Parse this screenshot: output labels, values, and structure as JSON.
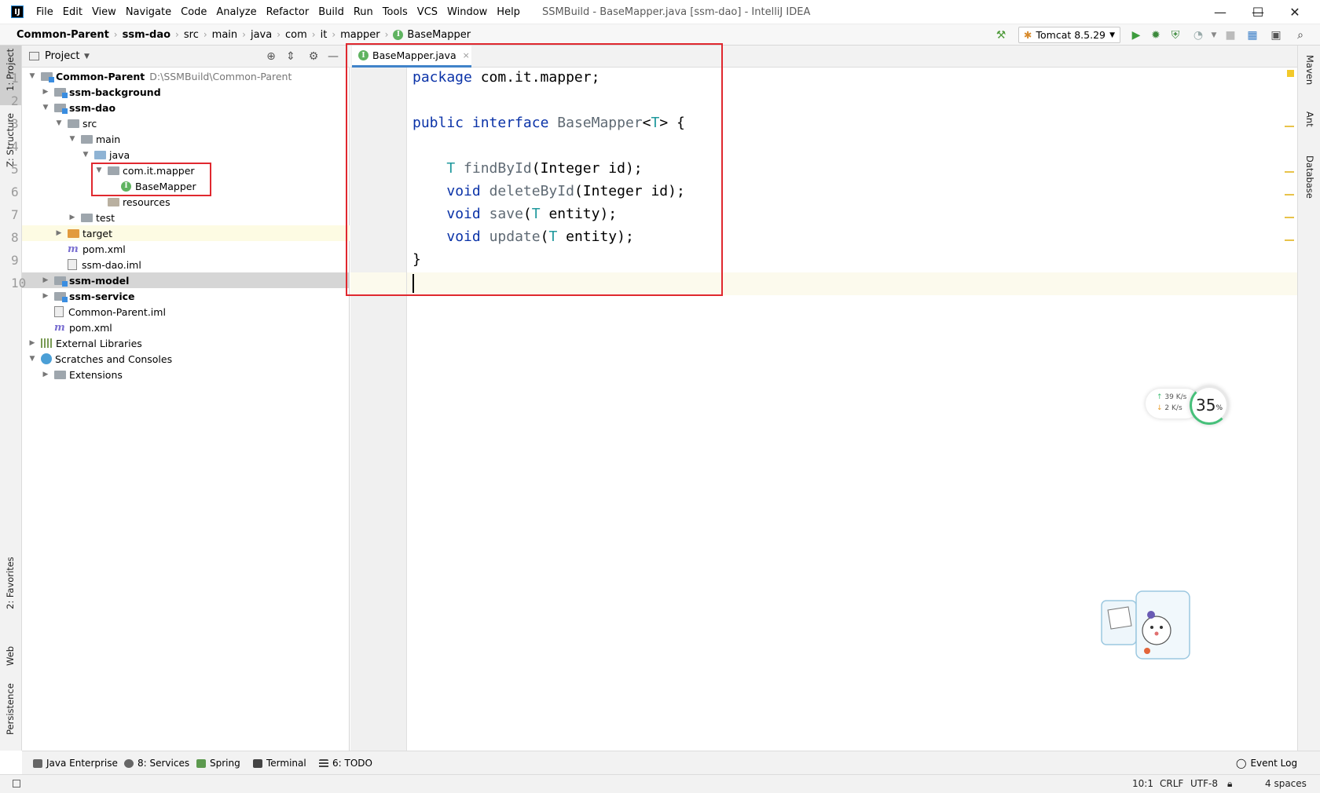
{
  "titlebar": {
    "logo": "IJ",
    "menu": [
      "File",
      "Edit",
      "View",
      "Navigate",
      "Code",
      "Analyze",
      "Refactor",
      "Build",
      "Run",
      "Tools",
      "VCS",
      "Window",
      "Help"
    ],
    "window_title": "SSMBuild - BaseMapper.java [ssm-dao] - IntelliJ IDEA",
    "controls": {
      "minimize": "—",
      "maximize": "☐",
      "close": "✕"
    }
  },
  "navbar": {
    "breadcrumbs": [
      "Common-Parent",
      "ssm-dao",
      "src",
      "main",
      "java",
      "com",
      "it",
      "mapper",
      "BaseMapper"
    ],
    "run_config": "Tomcat 8.5.29",
    "icons": [
      "build-hammer-icon",
      "run-icon",
      "debug-icon",
      "coverage-icon",
      "profile-icon",
      "stop-icon",
      "project-structure-icon",
      "layout-icon",
      "search-icon"
    ]
  },
  "left_strip": {
    "tabs": [
      "1: Project",
      "Z: Structure",
      "2: Favorites",
      "Web",
      "Persistence"
    ]
  },
  "right_strip": {
    "tabs": [
      "Maven",
      "Ant",
      "Database"
    ]
  },
  "project_panel": {
    "title": "Project",
    "tree": [
      {
        "label": "Common-Parent",
        "path": "D:\\SSMBuild\\Common-Parent",
        "bold": true,
        "depth": 0,
        "arrow": "down",
        "icon": "module"
      },
      {
        "label": "ssm-background",
        "bold": true,
        "depth": 1,
        "arrow": "right",
        "icon": "module"
      },
      {
        "label": "ssm-dao",
        "bold": true,
        "depth": 1,
        "arrow": "down",
        "icon": "module"
      },
      {
        "label": "src",
        "depth": 2,
        "arrow": "down",
        "icon": "folder"
      },
      {
        "label": "main",
        "depth": 3,
        "arrow": "down",
        "icon": "folder"
      },
      {
        "label": "java",
        "depth": 4,
        "arrow": "down",
        "icon": "src"
      },
      {
        "label": "com.it.mapper",
        "depth": 5,
        "arrow": "down",
        "icon": "folder"
      },
      {
        "label": "BaseMapper",
        "depth": 6,
        "arrow": "",
        "icon": "interface"
      },
      {
        "label": "resources",
        "depth": 5,
        "arrow": "",
        "icon": "res"
      },
      {
        "label": "test",
        "depth": 3,
        "arrow": "right",
        "icon": "folder"
      },
      {
        "label": "target",
        "depth": 2,
        "arrow": "right",
        "icon": "tgt"
      },
      {
        "label": "pom.xml",
        "depth": 2,
        "arrow": "",
        "icon": "maven"
      },
      {
        "label": "ssm-dao.iml",
        "depth": 2,
        "arrow": "",
        "icon": "iml"
      },
      {
        "label": "ssm-model",
        "bold": true,
        "depth": 1,
        "arrow": "right",
        "icon": "module"
      },
      {
        "label": "ssm-service",
        "bold": true,
        "depth": 1,
        "arrow": "right",
        "icon": "module"
      },
      {
        "label": "Common-Parent.iml",
        "depth": 1,
        "arrow": "",
        "icon": "iml"
      },
      {
        "label": "pom.xml",
        "depth": 1,
        "arrow": "",
        "icon": "maven"
      },
      {
        "label": "External Libraries",
        "depth": 0,
        "arrow": "right",
        "icon": "lib"
      },
      {
        "label": "Scratches and Consoles",
        "depth": 0,
        "arrow": "down",
        "icon": "scratch"
      },
      {
        "label": "Extensions",
        "depth": 1,
        "arrow": "right",
        "icon": "folder"
      }
    ]
  },
  "editor": {
    "tab_label": "BaseMapper.java",
    "tab_close": "×",
    "line_numbers": [
      "1",
      "2",
      "3",
      "4",
      "5",
      "6",
      "7",
      "8",
      "9",
      "10"
    ],
    "code": {
      "l1_kw": "package",
      "l1_rest": " com.it.mapper;",
      "l3_kw1": "public",
      "l3_kw2": "interface",
      "l3_name": "BaseMapper",
      "l3_lt": "<",
      "l3_t": "T",
      "l3_gt": "> {",
      "l5_t": "T",
      "l5_m": "findById",
      "l5_rest": "(Integer id);",
      "l6_kw": "void",
      "l6_m": "deleteById",
      "l6_rest": "(Integer id);",
      "l7_kw": "void",
      "l7_m": "save",
      "l7_open": "(",
      "l7_t": "T",
      "l7_rest": " entity);",
      "l8_kw": "void",
      "l8_m": "update",
      "l8_open": "(",
      "l8_t": "T",
      "l8_rest": " entity);",
      "l9": "}"
    }
  },
  "net_widget": {
    "up": "39",
    "down": "2",
    "unit": "K/s",
    "cpu": "35",
    "cpu_unit": "%"
  },
  "bottom_tabs": [
    "Java Enterprise",
    "8: Services",
    "Spring",
    "Terminal",
    "6: TODO"
  ],
  "event_log": "Event Log",
  "status": {
    "position": "10:1",
    "line_sep": "CRLF",
    "encoding": "UTF-8",
    "indent": "4 spaces"
  },
  "colors": {
    "annotation_red": "#e0282f",
    "keyword_blue": "#0b33a8",
    "type_teal": "#20999d",
    "accent_blue": "#4083c9"
  }
}
